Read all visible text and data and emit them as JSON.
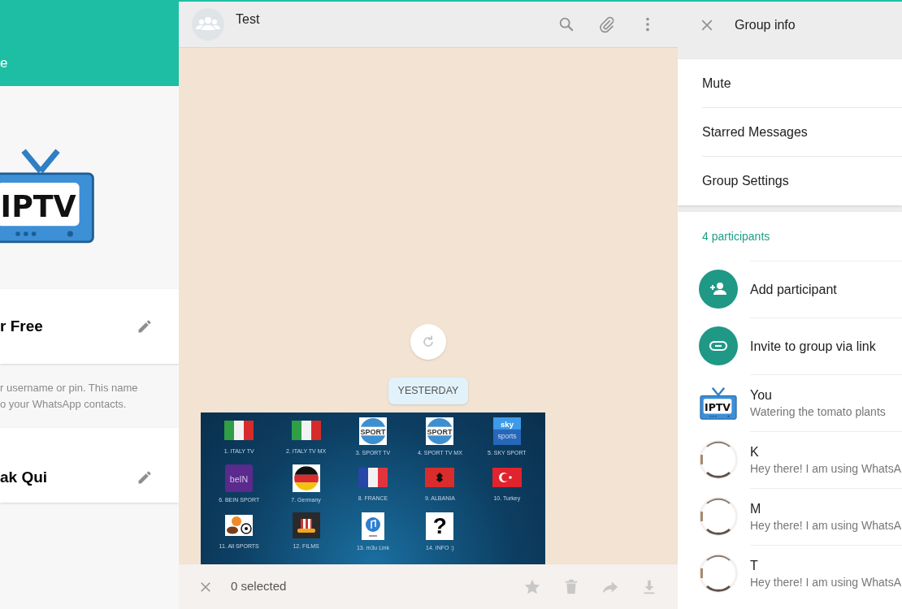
{
  "profile": {
    "header_title": "e",
    "logo_text": "IPTV",
    "name": "r Free",
    "name_hint": [
      "r username or pin. This name",
      "o your WhatsApp contacts."
    ],
    "about": "ak Qui"
  },
  "chat": {
    "title": "Test",
    "date_chip": "YESTERDAY",
    "image": {
      "tiles": [
        {
          "kind": "italy",
          "label": "1. ITALY TV"
        },
        {
          "kind": "italy",
          "label": "2. ITALY TV MX"
        },
        {
          "kind": "sport",
          "icon_text": "SPORT",
          "label": "3. SPORT TV"
        },
        {
          "kind": "sport",
          "icon_text": "SPORT",
          "label": "4. SPORT TV MX"
        },
        {
          "kind": "sky",
          "icon_text": "sky",
          "icon_subtext": "sports",
          "label": "5. SKY SPORT"
        },
        {
          "kind": "bein",
          "icon_text": "beIN",
          "label": "6. BEIN SPORT"
        },
        {
          "kind": "germany",
          "label": "7. Germany"
        },
        {
          "kind": "france",
          "label": "8. FRANCE"
        },
        {
          "kind": "albania",
          "label": "9. ALBANIA"
        },
        {
          "kind": "turkey",
          "label": "10. Turkey"
        },
        {
          "kind": "balls",
          "label": "11. All SPORTS"
        },
        {
          "kind": "films",
          "label": "12. FILMS"
        },
        {
          "kind": "music",
          "label": "13. m3u Link"
        },
        {
          "kind": "question",
          "icon_text": "?",
          "label": "14. INFO :)"
        }
      ]
    },
    "selection": {
      "count_text": "0 selected"
    }
  },
  "group_info": {
    "title": "Group info",
    "options": [
      "Mute",
      "Starred Messages",
      "Group Settings"
    ],
    "participants_heading": "4 participants",
    "actions": [
      {
        "kind": "add",
        "label": "Add participant"
      },
      {
        "kind": "link",
        "label": "Invite to group via link"
      }
    ],
    "participants": [
      {
        "kind": "logo",
        "logo_text": "IPTV",
        "name": "You",
        "status": "Watering the tomato plants"
      },
      {
        "name": "K",
        "status": "Hey there! I am using WhatsA"
      },
      {
        "name": "M",
        "status": "Hey there! I am using WhatsA"
      },
      {
        "name": "T",
        "status": "Hey there! I am using WhatsA"
      }
    ]
  }
}
